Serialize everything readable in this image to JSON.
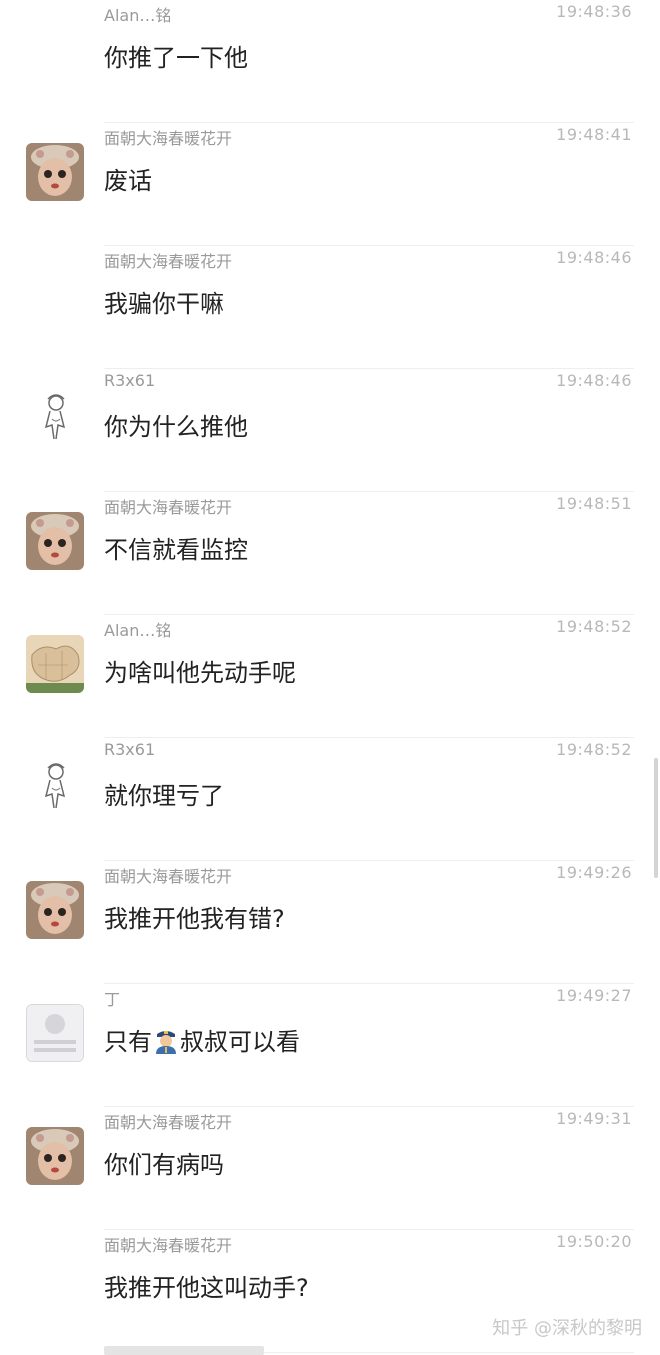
{
  "messages": [
    {
      "sender": "Alan…铭",
      "time": "19:48:36",
      "text": "你推了一下他",
      "avatar": "none"
    },
    {
      "sender": "面朝大海春暖花开",
      "time": "19:48:41",
      "text": "废话",
      "avatar": "doll"
    },
    {
      "sender": "面朝大海春暖花开",
      "time": "19:48:46",
      "text": "我骗你干嘛",
      "avatar": "none"
    },
    {
      "sender": "R3x61",
      "time": "19:48:46",
      "text": "你为什么推他",
      "avatar": "sketch"
    },
    {
      "sender": "面朝大海春暖花开",
      "time": "19:48:51",
      "text": "不信就看监控",
      "avatar": "doll"
    },
    {
      "sender": "Alan…铭",
      "time": "19:48:52",
      "text": "为啥叫他先动手呢",
      "avatar": "map"
    },
    {
      "sender": "R3x61",
      "time": "19:48:52",
      "text": "就你理亏了",
      "avatar": "sketch"
    },
    {
      "sender": "面朝大海春暖花开",
      "time": "19:49:26",
      "text": "我推开他我有错?",
      "avatar": "doll"
    },
    {
      "sender": "丁",
      "time": "19:49:27",
      "text_before": "只有",
      "text_after": "叔叔可以看",
      "emoji": "police-officer-emoji",
      "avatar": "default"
    },
    {
      "sender": "面朝大海春暖花开",
      "time": "19:49:31",
      "text": "你们有病吗",
      "avatar": "doll"
    },
    {
      "sender": "面朝大海春暖花开",
      "time": "19:50:20",
      "text": "我推开他这叫动手?",
      "avatar": "none"
    }
  ],
  "watermark": "知乎 @深秋的黎明",
  "colors": {
    "text": "#222222",
    "sender": "#9a9a9a",
    "time": "#b8b8b8",
    "divider": "#eeeeee"
  }
}
